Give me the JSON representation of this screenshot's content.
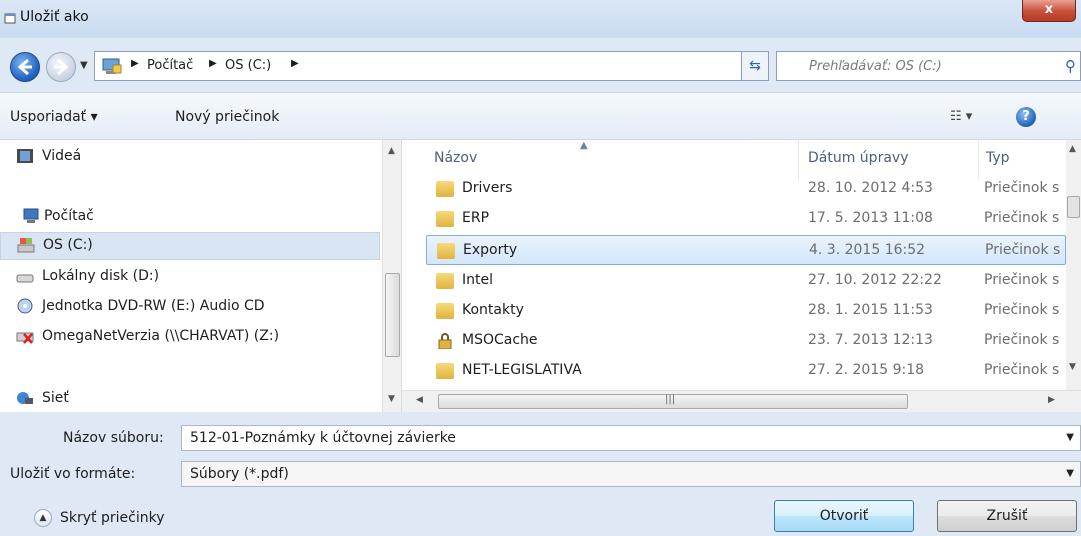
{
  "window": {
    "title": "Uložiť ako",
    "close_label": "x"
  },
  "address": {
    "breadcrumbs": [
      "Počítač",
      "OS (C:)"
    ],
    "search_placeholder": "Prehľadávať: OS (C:)"
  },
  "toolbar": {
    "organize_label": "Usporiadať ▾",
    "new_folder_label": "Nový priečinok",
    "view_label": "☷ ▾",
    "help_label": "?"
  },
  "nav": {
    "items": [
      {
        "label": "Videá",
        "icon": "video-icon"
      },
      {
        "label": "Počítač",
        "icon": "computer-icon"
      },
      {
        "label": "OS (C:)",
        "icon": "drive-icon",
        "selected": true
      },
      {
        "label": "Lokálny disk (D:)",
        "icon": "drive-icon"
      },
      {
        "label": "Jednotka DVD-RW (E:) Audio CD",
        "icon": "dvd-icon"
      },
      {
        "label": "OmegaNetVerzia (\\\\CHARVAT) (Z:)",
        "icon": "network-drive-icon"
      },
      {
        "label": "Sieť",
        "icon": "network-icon"
      }
    ]
  },
  "files": {
    "columns": {
      "name": "Názov",
      "date": "Dátum úpravy",
      "type": "Typ"
    },
    "rows": [
      {
        "name": "Drivers",
        "date": "28. 10. 2012 4:53",
        "type": "Priečinok s"
      },
      {
        "name": "ERP",
        "date": "17. 5. 2013 11:08",
        "type": "Priečinok s"
      },
      {
        "name": "Exporty",
        "date": "4. 3. 2015 16:52",
        "type": "Priečinok s",
        "selected": true
      },
      {
        "name": "Intel",
        "date": "27. 10. 2012 22:22",
        "type": "Priečinok s"
      },
      {
        "name": "Kontakty",
        "date": "28. 1. 2015 11:53",
        "type": "Priečinok s"
      },
      {
        "name": "MSOCache",
        "date": "23. 7. 2013 12:13",
        "type": "Priečinok s"
      },
      {
        "name": "NET-LEGISLATIVA",
        "date": "27. 2. 2015 9:18",
        "type": "Priečinok s"
      }
    ]
  },
  "form": {
    "filename_label": "Názov súboru:",
    "filename_value": "512-01-Poznámky k účtovnej závierke",
    "format_label": "Uložiť vo formáte:",
    "format_value": "Súbory (*.pdf)",
    "hide_folders_label": "Skryť priečinky",
    "open_label": "Otvoriť",
    "cancel_label": "Zrušiť"
  }
}
